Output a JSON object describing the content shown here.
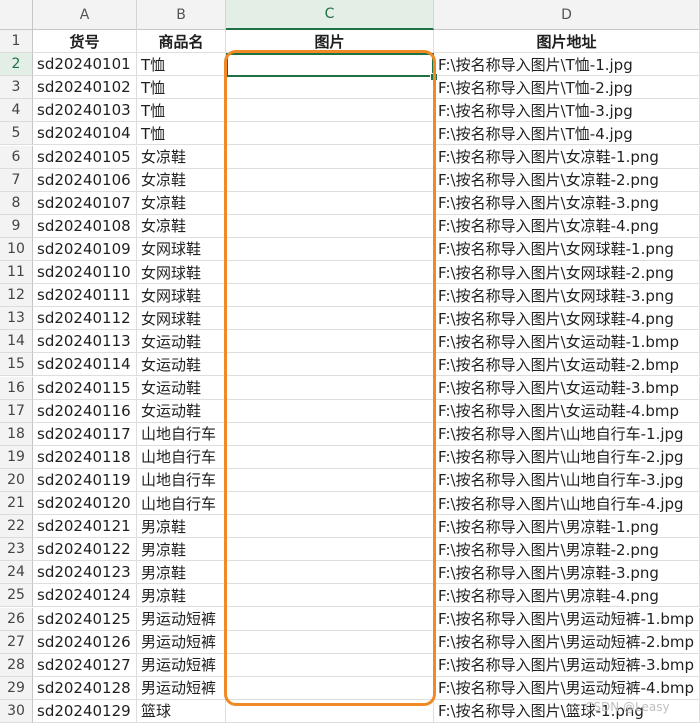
{
  "columns": [
    "A",
    "B",
    "C",
    "D"
  ],
  "active_column": "C",
  "headers": {
    "a": "货号",
    "b": "商品名",
    "c": "图片",
    "d": "图片地址"
  },
  "rows": [
    {
      "num": "1"
    },
    {
      "num": "2",
      "a": "sd20240101",
      "b": "T恤",
      "c": "",
      "d": "F:\\按名称导入图片\\T恤-1.jpg"
    },
    {
      "num": "3",
      "a": "sd20240102",
      "b": "T恤",
      "c": "",
      "d": "F:\\按名称导入图片\\T恤-2.jpg"
    },
    {
      "num": "4",
      "a": "sd20240103",
      "b": "T恤",
      "c": "",
      "d": "F:\\按名称导入图片\\T恤-3.jpg"
    },
    {
      "num": "5",
      "a": "sd20240104",
      "b": "T恤",
      "c": "",
      "d": "F:\\按名称导入图片\\T恤-4.jpg"
    },
    {
      "num": "6",
      "a": "sd20240105",
      "b": "女凉鞋",
      "c": "",
      "d": "F:\\按名称导入图片\\女凉鞋-1.png"
    },
    {
      "num": "7",
      "a": "sd20240106",
      "b": "女凉鞋",
      "c": "",
      "d": "F:\\按名称导入图片\\女凉鞋-2.png"
    },
    {
      "num": "8",
      "a": "sd20240107",
      "b": "女凉鞋",
      "c": "",
      "d": "F:\\按名称导入图片\\女凉鞋-3.png"
    },
    {
      "num": "9",
      "a": "sd20240108",
      "b": "女凉鞋",
      "c": "",
      "d": "F:\\按名称导入图片\\女凉鞋-4.png"
    },
    {
      "num": "10",
      "a": "sd20240109",
      "b": "女网球鞋",
      "c": "",
      "d": "F:\\按名称导入图片\\女网球鞋-1.png"
    },
    {
      "num": "11",
      "a": "sd20240110",
      "b": "女网球鞋",
      "c": "",
      "d": "F:\\按名称导入图片\\女网球鞋-2.png"
    },
    {
      "num": "12",
      "a": "sd20240111",
      "b": "女网球鞋",
      "c": "",
      "d": "F:\\按名称导入图片\\女网球鞋-3.png"
    },
    {
      "num": "13",
      "a": "sd20240112",
      "b": "女网球鞋",
      "c": "",
      "d": "F:\\按名称导入图片\\女网球鞋-4.png"
    },
    {
      "num": "14",
      "a": "sd20240113",
      "b": "女运动鞋",
      "c": "",
      "d": "F:\\按名称导入图片\\女运动鞋-1.bmp"
    },
    {
      "num": "15",
      "a": "sd20240114",
      "b": "女运动鞋",
      "c": "",
      "d": "F:\\按名称导入图片\\女运动鞋-2.bmp"
    },
    {
      "num": "16",
      "a": "sd20240115",
      "b": "女运动鞋",
      "c": "",
      "d": "F:\\按名称导入图片\\女运动鞋-3.bmp"
    },
    {
      "num": "17",
      "a": "sd20240116",
      "b": "女运动鞋",
      "c": "",
      "d": "F:\\按名称导入图片\\女运动鞋-4.bmp"
    },
    {
      "num": "18",
      "a": "sd20240117",
      "b": "山地自行车",
      "c": "",
      "d": "F:\\按名称导入图片\\山地自行车-1.jpg"
    },
    {
      "num": "19",
      "a": "sd20240118",
      "b": "山地自行车",
      "c": "",
      "d": "F:\\按名称导入图片\\山地自行车-2.jpg"
    },
    {
      "num": "20",
      "a": "sd20240119",
      "b": "山地自行车",
      "c": "",
      "d": "F:\\按名称导入图片\\山地自行车-3.jpg"
    },
    {
      "num": "21",
      "a": "sd20240120",
      "b": "山地自行车",
      "c": "",
      "d": "F:\\按名称导入图片\\山地自行车-4.jpg"
    },
    {
      "num": "22",
      "a": "sd20240121",
      "b": "男凉鞋",
      "c": "",
      "d": "F:\\按名称导入图片\\男凉鞋-1.png"
    },
    {
      "num": "23",
      "a": "sd20240122",
      "b": "男凉鞋",
      "c": "",
      "d": "F:\\按名称导入图片\\男凉鞋-2.png"
    },
    {
      "num": "24",
      "a": "sd20240123",
      "b": "男凉鞋",
      "c": "",
      "d": "F:\\按名称导入图片\\男凉鞋-3.png"
    },
    {
      "num": "25",
      "a": "sd20240124",
      "b": "男凉鞋",
      "c": "",
      "d": "F:\\按名称导入图片\\男凉鞋-4.png"
    },
    {
      "num": "26",
      "a": "sd20240125",
      "b": "男运动短裤",
      "c": "",
      "d": "F:\\按名称导入图片\\男运动短裤-1.bmp"
    },
    {
      "num": "27",
      "a": "sd20240126",
      "b": "男运动短裤",
      "c": "",
      "d": "F:\\按名称导入图片\\男运动短裤-2.bmp"
    },
    {
      "num": "28",
      "a": "sd20240127",
      "b": "男运动短裤",
      "c": "",
      "d": "F:\\按名称导入图片\\男运动短裤-3.bmp"
    },
    {
      "num": "29",
      "a": "sd20240128",
      "b": "男运动短裤",
      "c": "",
      "d": "F:\\按名称导入图片\\男运动短裤-4.bmp"
    },
    {
      "num": "30",
      "a": "sd20240129",
      "b": "篮球",
      "c": "",
      "d": "F:\\按名称导入图片\\篮球-1.png"
    }
  ],
  "selected_cell": "C2",
  "watermark": "CSDN @Leasy",
  "colors": {
    "accent": "#1e7145",
    "highlight": "#f08a24"
  }
}
